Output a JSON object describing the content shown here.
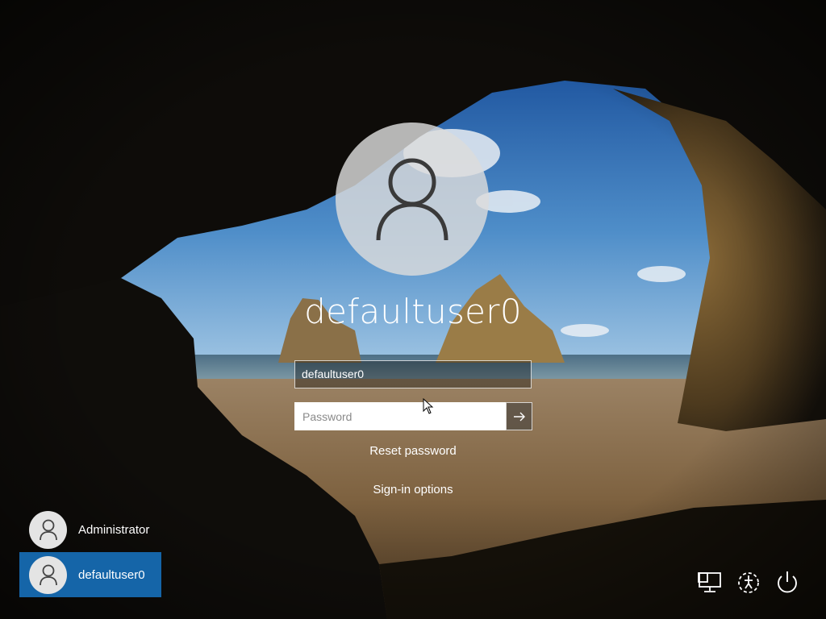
{
  "account": {
    "display_name": "defaultuser0",
    "username_value": "defaultuser0"
  },
  "password": {
    "placeholder": "Password",
    "value": ""
  },
  "links": {
    "reset_password": "Reset password",
    "sign_in_options": "Sign-in options"
  },
  "user_list": [
    {
      "name": "Administrator",
      "selected": false
    },
    {
      "name": "defaultuser0",
      "selected": true
    }
  ],
  "system_buttons": {
    "network_icon": "network-icon",
    "ease_of_access_icon": "ease-of-access-icon",
    "power_icon": "power-icon"
  },
  "colors": {
    "selected_user_bg": "#1565a8",
    "sky": "#2f6fb0",
    "sand": "#a98a5c"
  }
}
